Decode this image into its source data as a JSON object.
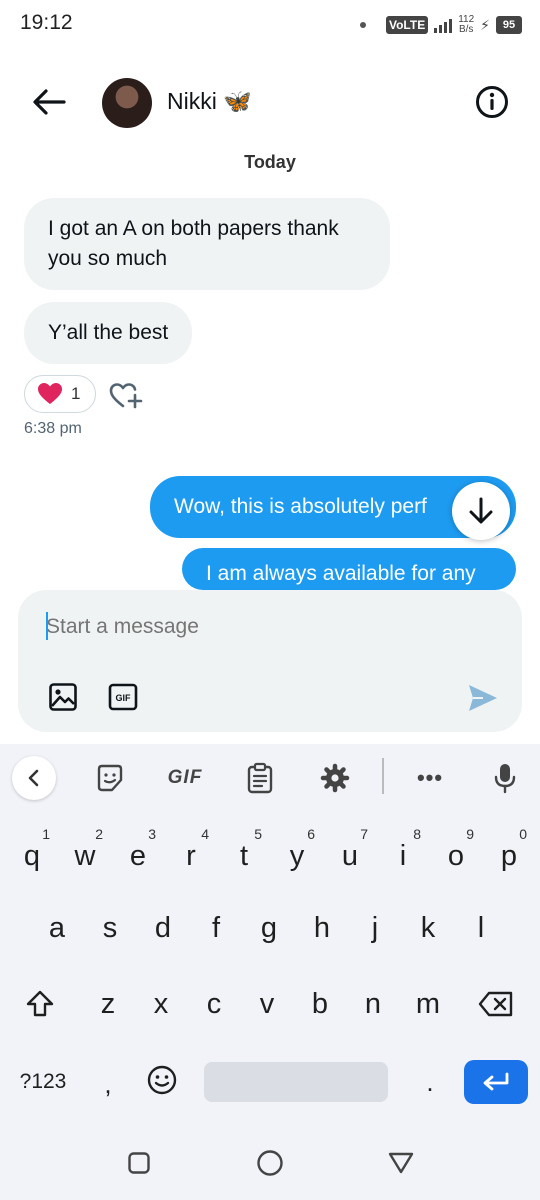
{
  "status_bar": {
    "time": "19:12",
    "network": "VoLTE",
    "speed_value": "112",
    "speed_unit": "B/s",
    "battery": "95"
  },
  "header": {
    "contact_name": "Nikki 🦋",
    "back_icon": "arrow-left-icon",
    "info_icon": "info-circle-icon"
  },
  "conversation": {
    "date_separator": "Today",
    "incoming_messages": [
      "I got an A on both papers thank you so much",
      "Y’all the best"
    ],
    "reaction": {
      "emoji": "❤️",
      "count": "1"
    },
    "timestamp": "6:38 pm",
    "outgoing_messages": [
      "Wow, this is absolutely perf",
      "I am always available for any"
    ]
  },
  "composer": {
    "placeholder": "Start a message",
    "gif_label": "GIF"
  },
  "keyboard": {
    "toolbar": {
      "gif": "GIF",
      "more": "•••"
    },
    "row1": [
      {
        "k": "q",
        "h": "1"
      },
      {
        "k": "w",
        "h": "2"
      },
      {
        "k": "e",
        "h": "3"
      },
      {
        "k": "r",
        "h": "4"
      },
      {
        "k": "t",
        "h": "5"
      },
      {
        "k": "y",
        "h": "6"
      },
      {
        "k": "u",
        "h": "7"
      },
      {
        "k": "i",
        "h": "8"
      },
      {
        "k": "o",
        "h": "9"
      },
      {
        "k": "p",
        "h": "0"
      }
    ],
    "row2": [
      "a",
      "s",
      "d",
      "f",
      "g",
      "h",
      "j",
      "k",
      "l"
    ],
    "row3": [
      "z",
      "x",
      "c",
      "v",
      "b",
      "n",
      "m"
    ],
    "symbols_key": "?123",
    "comma_key": ",",
    "period_key": "."
  },
  "colors": {
    "accent": "#1d9bf0",
    "incoming_bubble": "#eff3f4",
    "keyboard_bg": "#f1f3f8",
    "enter_key": "#1a73e8",
    "heart": "#e0245e"
  }
}
